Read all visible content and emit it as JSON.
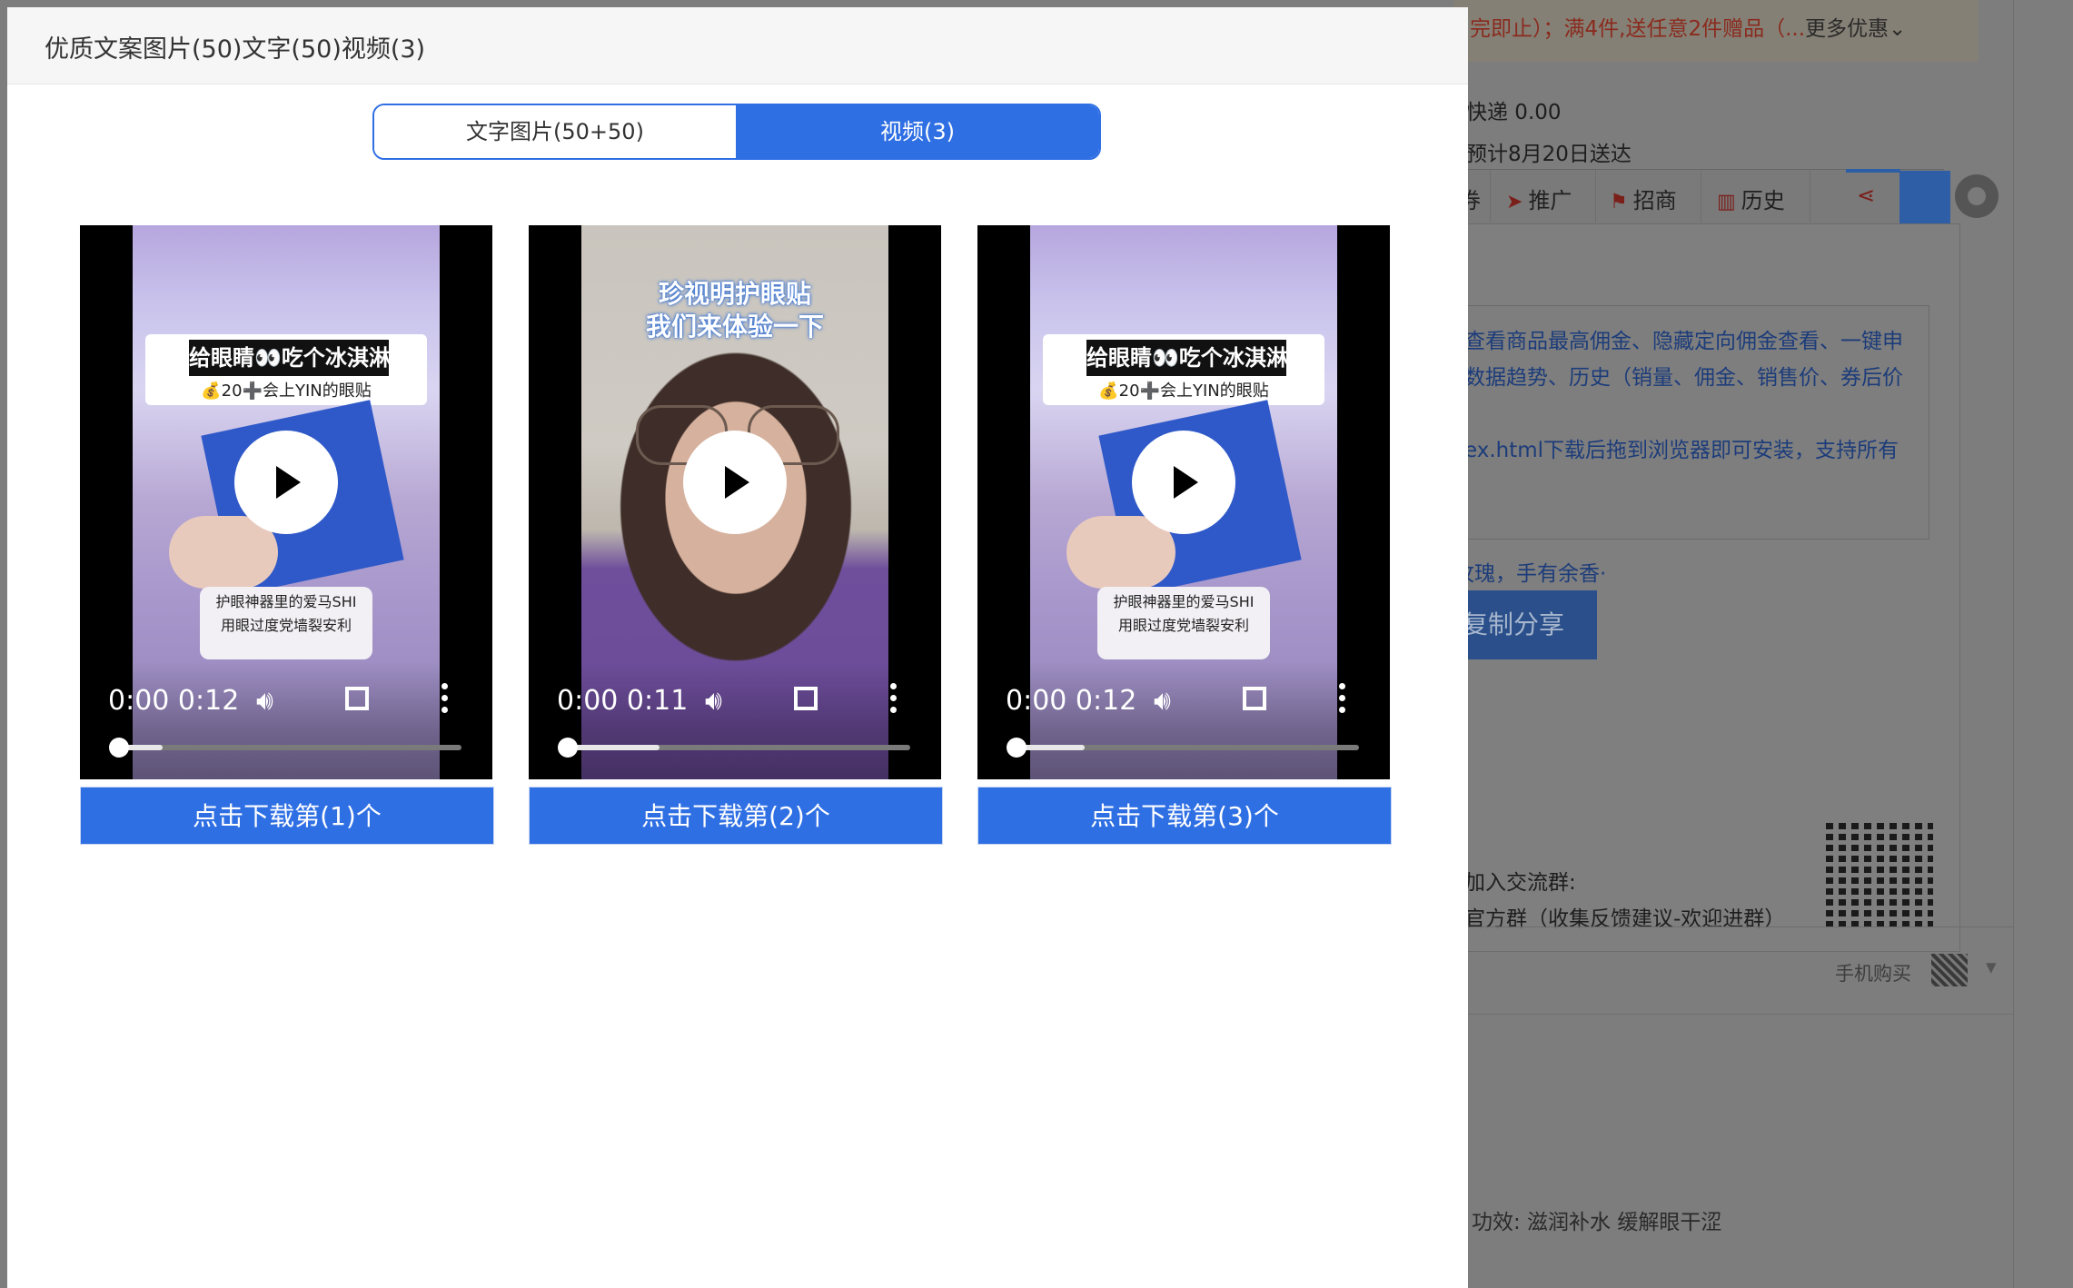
{
  "background": {
    "promo_text": "完即止）；满4件,送任意2件赠品（...",
    "promo_more": "更多优惠",
    "shipping": "快递 0.00",
    "delivery": "预计8月20日送达",
    "toolbar": {
      "partial": "券",
      "items": [
        {
          "label": "推广",
          "icon": "send-icon"
        },
        {
          "label": "招商",
          "icon": "flag-icon"
        },
        {
          "label": "历史",
          "icon": "chart-icon"
        }
      ]
    },
    "textarea_lines": [
      "查看商品最高佣金、隐藏定向佣金查看、一键申",
      "数据趋势、历史（销量、佣金、销售价、券后价",
      "",
      "ex.html下载后拖到浏览器即可安装，支持所有"
    ],
    "slogan": "玫瑰，手有余香·",
    "copy_button": "复制分享",
    "join_group": "加入交流群:",
    "official_group": "官方群（收集反馈建议-欢迎进群）",
    "mobile_buy": "手机购买",
    "efficacy": "功效: 滋润补水 缓解眼干涩"
  },
  "modal": {
    "title": "优质文案图片(50)文字(50)视频(3)",
    "tabs": [
      {
        "label": "文字图片(50+50)",
        "active": false
      },
      {
        "label": "视频(3)",
        "active": true
      }
    ]
  },
  "videos": [
    {
      "current_time": "0:00",
      "duration": "0:12",
      "progress_buffered": 0.13,
      "caption_top": "给眼睛👀吃个冰淇淋",
      "caption_sub": "💰20➕会上YIN的眼贴",
      "caption_bottom_1": "护眼神器里的爱马SHI",
      "caption_bottom_2": "用眼过度党墙裂安利",
      "download_label": "点击下载第(1)个"
    },
    {
      "current_time": "0:00",
      "duration": "0:11",
      "progress_buffered": 0.27,
      "caption_top_1": "珍视明护眼贴",
      "caption_top_2": "我们来体验一下",
      "download_label": "点击下载第(2)个"
    },
    {
      "current_time": "0:00",
      "duration": "0:12",
      "progress_buffered": 0.2,
      "caption_top": "给眼睛👀吃个冰淇淋",
      "caption_sub": "💰20➕会上YIN的眼贴",
      "caption_bottom_1": "护眼神器里的爱马SHI",
      "caption_bottom_2": "用眼过度党墙裂安利",
      "download_label": "点击下载第(3)个"
    }
  ],
  "colors": {
    "accent": "#2f6fe4",
    "overlay": "#7d7d7d"
  }
}
